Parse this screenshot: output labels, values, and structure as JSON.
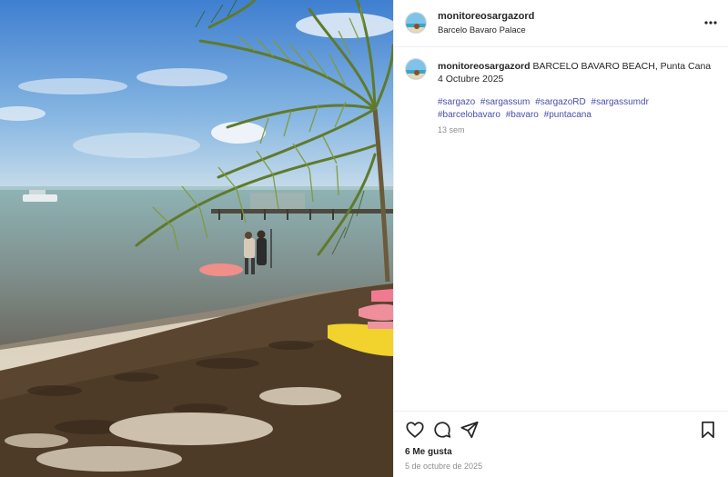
{
  "post": {
    "username": "monitoreosargazord",
    "location": "Barcelo Bavaro Palace",
    "caption": {
      "username": "monitoreosargazord",
      "line1": "BARCELO BAVARO BEACH, Punta Cana",
      "line2": "4 Octubre 2025",
      "hashtags": [
        "#sargazo",
        "#sargassum",
        "#sargazoRD",
        "#sargassumdr",
        "#barcelobavaro",
        "#bavaro",
        "#puntacana"
      ],
      "age": "13 sem"
    },
    "likes": "6 Me gusta",
    "date": "5 de octubre de 2025"
  },
  "icons": {
    "more": "more-horizontal-icon",
    "like": "heart-icon",
    "comment": "comment-icon",
    "share": "send-icon",
    "save": "bookmark-icon"
  },
  "colors": {
    "hashtag": "#4a4ea8",
    "muted": "#8e8e8e",
    "text": "#262626"
  }
}
